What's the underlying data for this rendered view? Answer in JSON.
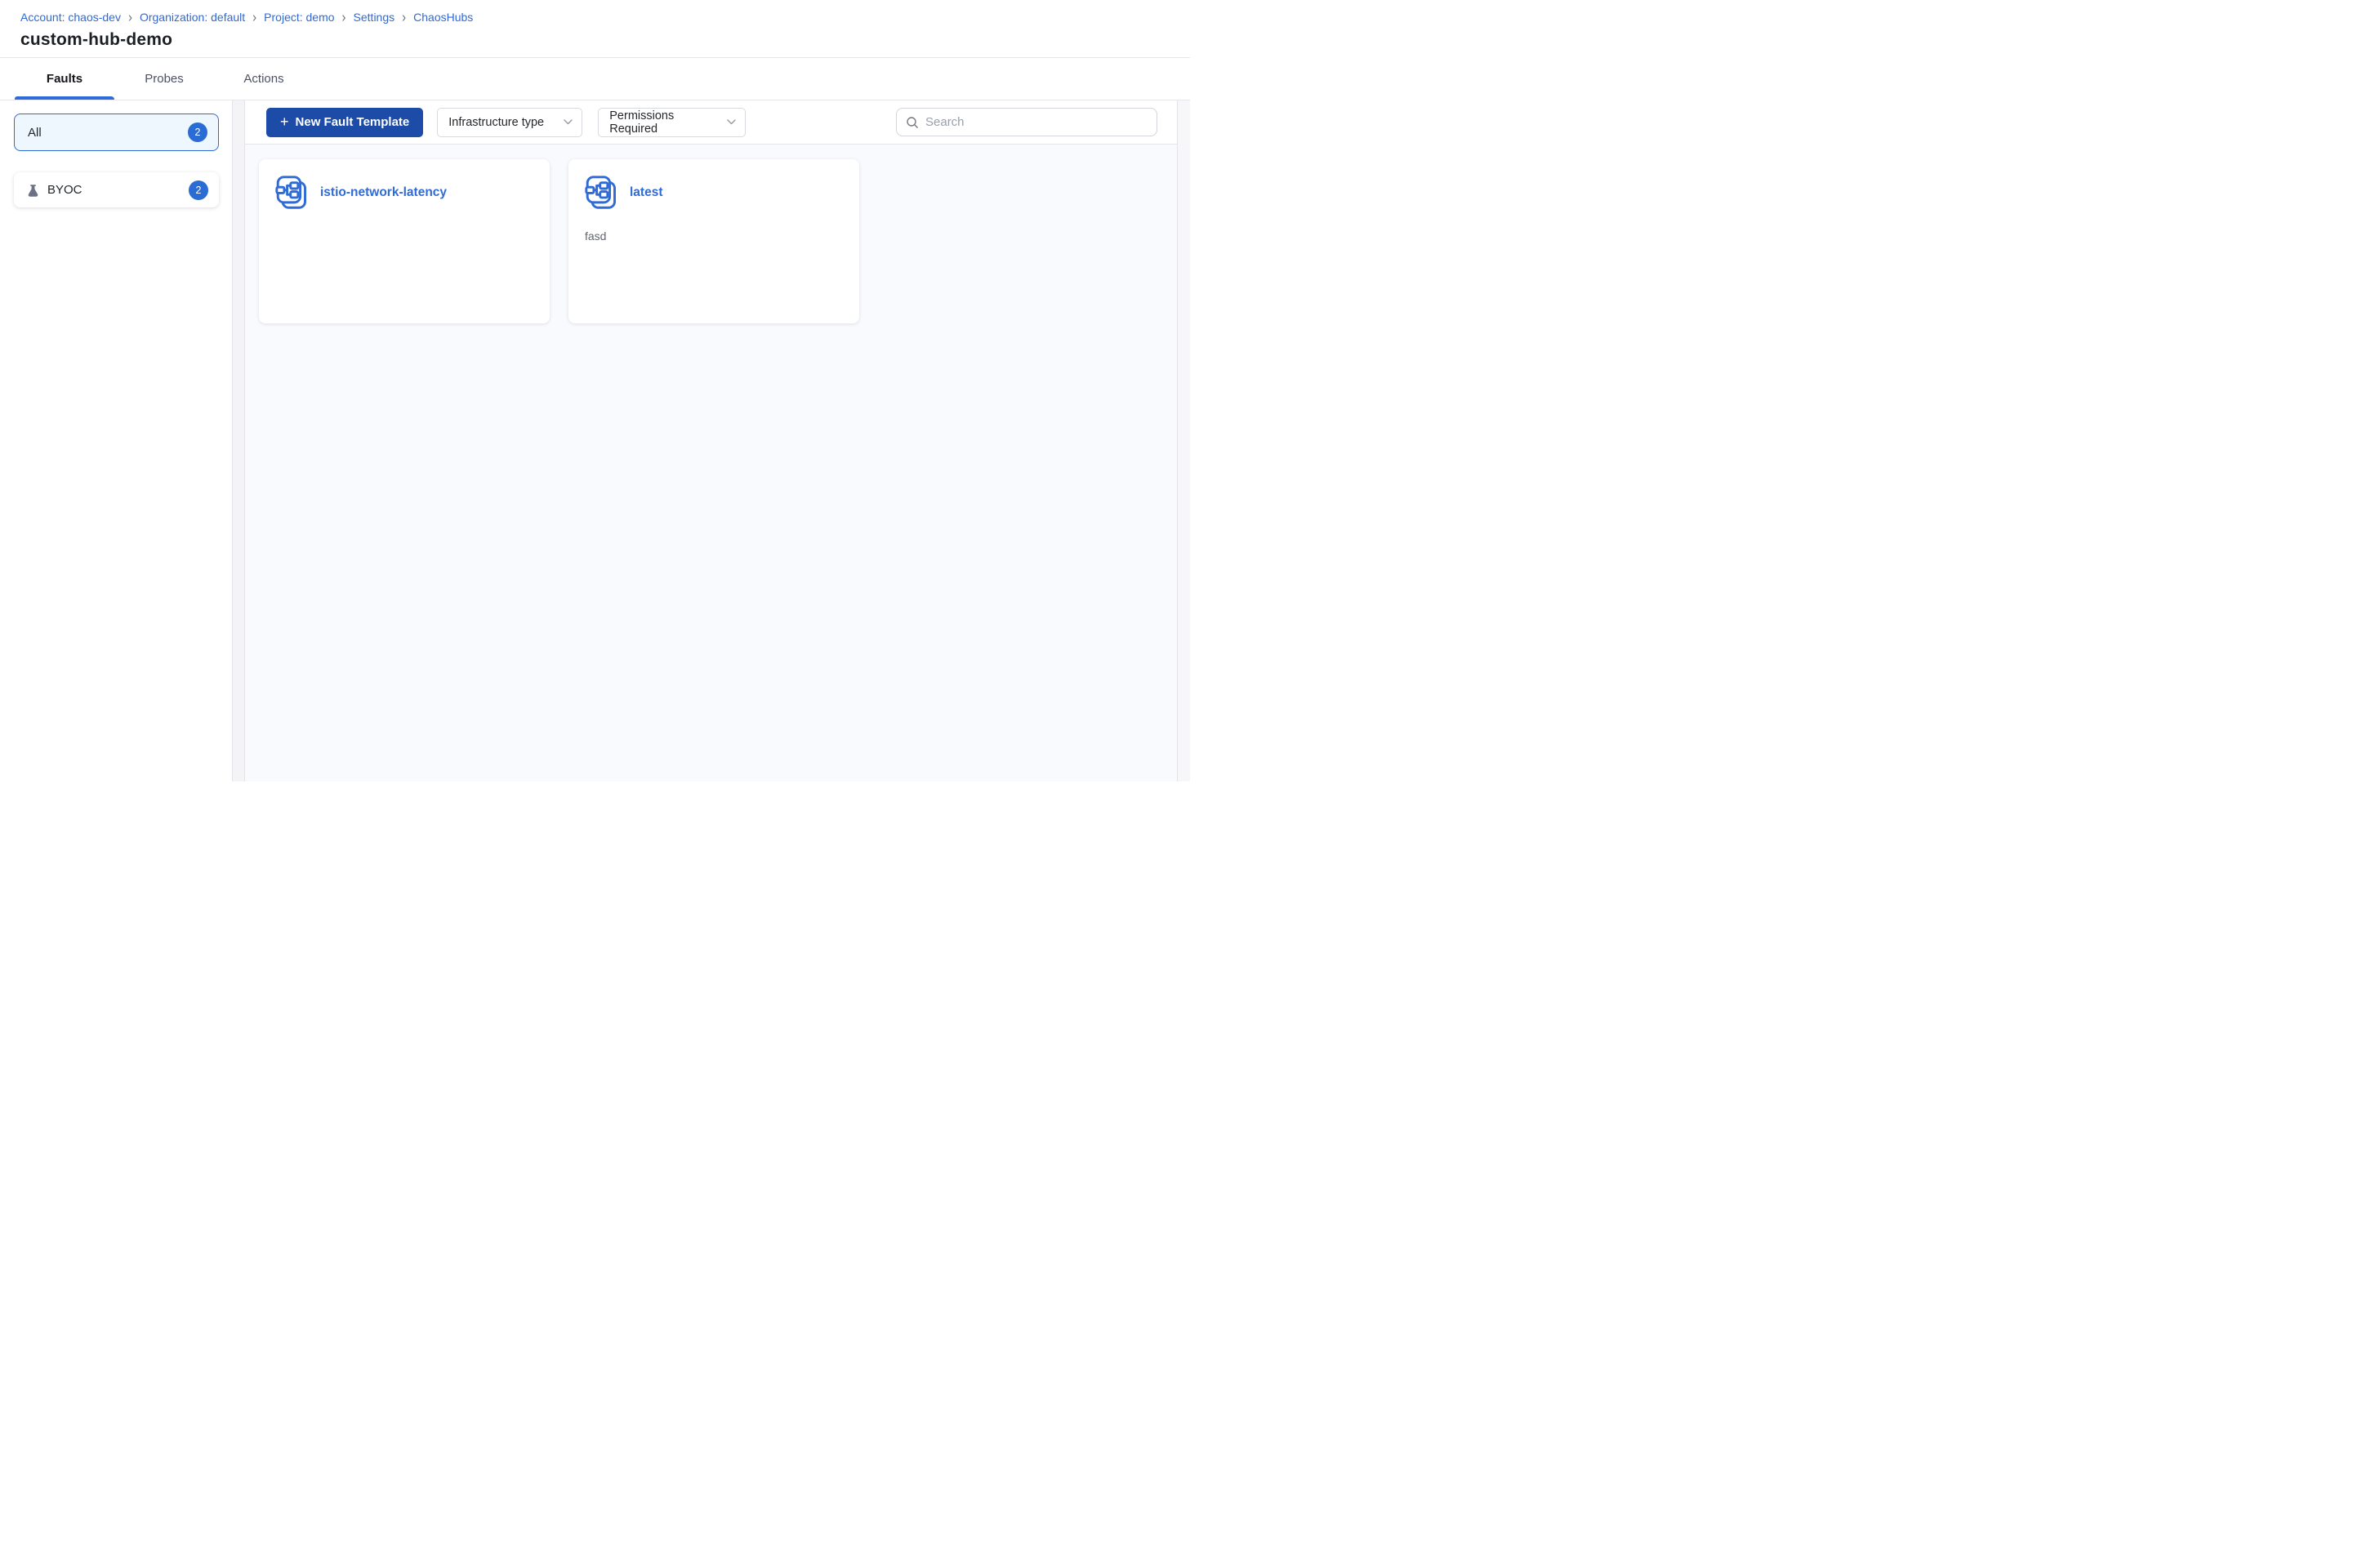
{
  "breadcrumb": {
    "separator": "›",
    "items": [
      {
        "label": "Account: chaos-dev"
      },
      {
        "label": "Organization: default"
      },
      {
        "label": "Project: demo"
      },
      {
        "label": "Settings"
      },
      {
        "label": "ChaosHubs"
      }
    ]
  },
  "header": {
    "title": "custom-hub-demo"
  },
  "tabs": [
    {
      "label": "Faults",
      "active": true
    },
    {
      "label": "Probes",
      "active": false
    },
    {
      "label": "Actions",
      "active": false
    }
  ],
  "sidebar": {
    "filters": [
      {
        "label": "All",
        "count": "2",
        "selected": true
      },
      {
        "label": "BYOC",
        "count": "2",
        "selected": false,
        "icon": "flask-icon"
      }
    ]
  },
  "toolbar": {
    "new_button": {
      "icon": "+",
      "label": "New Fault Template"
    },
    "dropdowns": [
      {
        "label": "Infrastructure type"
      },
      {
        "label": "Permissions Required"
      }
    ],
    "search": {
      "placeholder": "Search"
    }
  },
  "cards": [
    {
      "title": "istio-network-latency",
      "description": ""
    },
    {
      "title": "latest",
      "description": "fasd"
    }
  ],
  "colors": {
    "accent_blue": "#2e6bd6",
    "link_blue": "#3069d6",
    "button_blue": "#1d4ba8",
    "badge_blue": "#2b6cd4",
    "selected_filter_bg": "#edf7fd",
    "selected_filter_border": "#2f6bd6",
    "content_bg": "#f8fafd",
    "flask_gray": "#6b7286"
  }
}
